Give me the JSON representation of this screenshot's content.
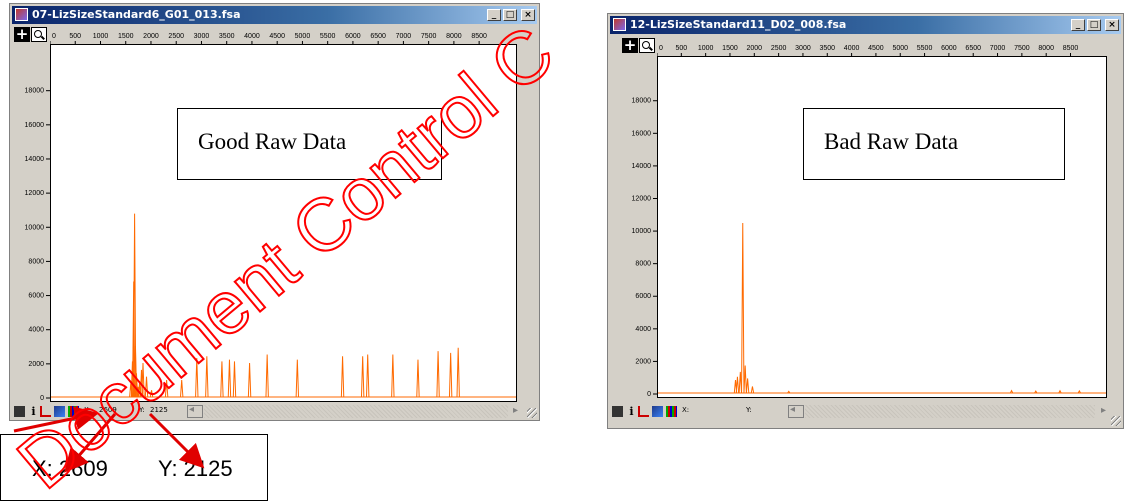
{
  "windows": [
    {
      "id": "left",
      "title": "07-LizSizeStandard6_G01_013.fsa",
      "annotation": "Good Raw Data",
      "status": {
        "x_label": "X:",
        "x_value": "2609",
        "y_label": "Y:",
        "y_value": "2125"
      },
      "trace_color": "#ff6a00",
      "peaks": [
        [
          1587,
          800
        ],
        [
          1620,
          2100
        ],
        [
          1645,
          6800
        ],
        [
          1663,
          10800
        ],
        [
          1680,
          3000
        ],
        [
          1700,
          1400
        ],
        [
          1730,
          600
        ],
        [
          1760,
          800
        ],
        [
          1800,
          1600
        ],
        [
          1830,
          2000
        ],
        [
          1900,
          1200
        ],
        [
          2000,
          400
        ],
        [
          2300,
          1000
        ],
        [
          2600,
          1000
        ],
        [
          2900,
          2300
        ],
        [
          3100,
          2400
        ],
        [
          3400,
          2100
        ],
        [
          3550,
          2200
        ],
        [
          3650,
          2100
        ],
        [
          3950,
          2000
        ],
        [
          4300,
          2500
        ],
        [
          4900,
          2200
        ],
        [
          5800,
          2400
        ],
        [
          6200,
          2400
        ],
        [
          6300,
          2500
        ],
        [
          6800,
          2500
        ],
        [
          7300,
          2200
        ],
        [
          7700,
          2700
        ],
        [
          7950,
          2600
        ],
        [
          8100,
          2900
        ]
      ]
    },
    {
      "id": "right",
      "title": "12-LizSizeStandard11_D02_008.fsa",
      "annotation": "Bad Raw Data",
      "status": {
        "x_label": "X:",
        "x_value": "",
        "y_label": "Y:",
        "y_value": ""
      },
      "trace_color": "#ff6a00",
      "peaks": [
        [
          1750,
          10500
        ],
        [
          1700,
          1300
        ],
        [
          1640,
          1000
        ],
        [
          1600,
          800
        ],
        [
          1800,
          1700
        ],
        [
          1850,
          900
        ],
        [
          1950,
          400
        ],
        [
          2700,
          100
        ],
        [
          7300,
          150
        ],
        [
          7800,
          120
        ],
        [
          8300,
          140
        ],
        [
          8700,
          130
        ]
      ]
    }
  ],
  "axis": {
    "x_ticks": [
      "0",
      "500",
      "1000",
      "1500",
      "2000",
      "2500",
      "3000",
      "3500",
      "4000",
      "4500",
      "5000",
      "5500",
      "6000",
      "6500",
      "7000",
      "7500",
      "8000",
      "8500"
    ],
    "y_ticks": [
      "0",
      "2000",
      "4000",
      "6000",
      "8000",
      "10000",
      "12000",
      "14000",
      "16000",
      "18000"
    ],
    "x_max": 9250,
    "y_max": 20500
  },
  "callout": {
    "x_text": "X: 2609",
    "y_text": "Y: 2125"
  },
  "watermark": {
    "text": "Document Control C",
    "color": "#ff0000"
  },
  "colors": {
    "titlebar": "#0a246a",
    "arrow": "#e00000"
  },
  "buttons": {
    "minimize": "_",
    "maximize": "□",
    "close": "×"
  }
}
